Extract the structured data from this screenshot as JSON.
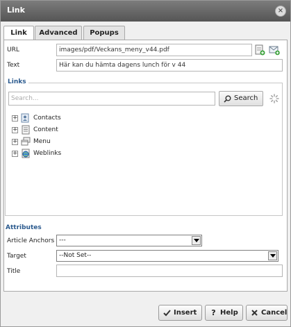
{
  "window": {
    "title": "Link",
    "close_label": "×"
  },
  "tabs": [
    {
      "label": "Link"
    },
    {
      "label": "Advanced"
    },
    {
      "label": "Popups"
    }
  ],
  "link": {
    "url_label": "URL",
    "url_value": "images/pdf/Veckans_meny_v44.pdf",
    "text_label": "Text",
    "text_value": "Här kan du hämta dagens lunch för v 44"
  },
  "links": {
    "legend": "Links",
    "search_placeholder": "Search...",
    "search_button": "Search",
    "tree": [
      {
        "label": "Contacts",
        "icon": "contacts-icon"
      },
      {
        "label": "Content",
        "icon": "content-icon"
      },
      {
        "label": "Menu",
        "icon": "menu-icon"
      },
      {
        "label": "Weblinks",
        "icon": "weblinks-icon"
      }
    ]
  },
  "attributes": {
    "heading": "Attributes",
    "anchors_label": "Article Anchors",
    "anchors_value": "---",
    "target_label": "Target",
    "target_value": "--Not Set--",
    "title_label": "Title",
    "title_value": ""
  },
  "buttons": {
    "insert": "Insert",
    "help": "Help",
    "cancel": "Cancel"
  }
}
